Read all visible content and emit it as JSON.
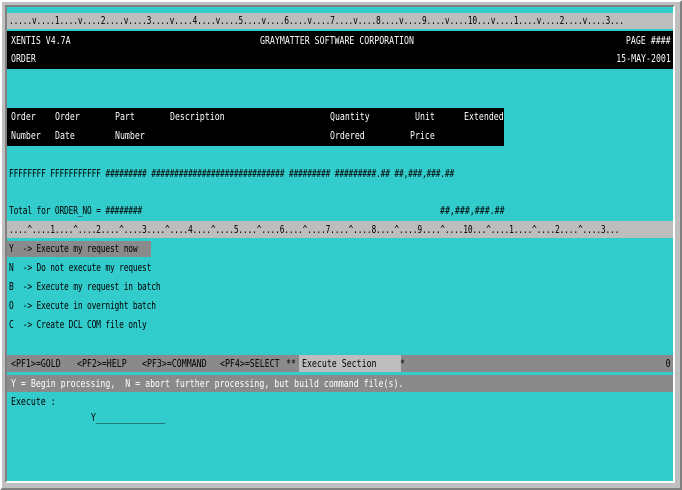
{
  "ruler_top": ".....v....1....v....2....v....3....v....4....v....5....v....6....v....7....v....8....v....9....v....10...v....1....v....2....v....3...",
  "header": {
    "app_version": "XENTIS V4.7A",
    "company": "GRAYMATTER SOFTWARE CORPORATION",
    "page_label": "PAGE ####",
    "report_name": "ORDER",
    "date": "15-MAY-2001"
  },
  "columns_row1": [
    "Order",
    "Order",
    "Part",
    "Description",
    "Quantity",
    "Unit",
    "Extended"
  ],
  "columns_row2": [
    "Number",
    "Date",
    "Number",
    "",
    "Ordered",
    "Price",
    ""
  ],
  "detail_line": "FFFFFFFF FFFFFFFFFFF ######### ############################# ######### #########.## ##,###,###.##",
  "total": {
    "label": "Total for ORDER_NO = ########",
    "amount": "##,###,###.##"
  },
  "ruler_bottom": "....^....1....^....2....^....3....^....4....^....5....^....6....^....7....^....8....^....9....^....10...^....1....^....2....^....3...",
  "options": [
    {
      "key": "Y",
      "text": "Y  -> Execute my request now"
    },
    {
      "key": "N",
      "text": "N  -> Do not execute my request"
    },
    {
      "key": "B",
      "text": "B  -> Execute my request in batch"
    },
    {
      "key": "O",
      "text": "O  -> Execute in overnight batch"
    },
    {
      "key": "C",
      "text": "C  -> Create DCL COM file only"
    }
  ],
  "function_keys": {
    "pf1": "<PF1>=GOLD",
    "pf2": "<PF2>=HELP",
    "pf3": "<PF3>=COMMAND",
    "pf4": "<PF4>=SELECT",
    "stars": "**",
    "section": "Execute Section",
    "star_end": "*",
    "right_marker": "0"
  },
  "help_line": "Y = Begin processing,  N = abort further processing, but build command file(s).",
  "prompt": {
    "label": "Execute : ",
    "value": "Y",
    "field_fill": "______________"
  },
  "colors": {
    "screen_bg": "#33cccc",
    "band_black": "#000000",
    "band_gray": "#bdbdbd",
    "band_dark_gray": "#8a8a8a"
  }
}
